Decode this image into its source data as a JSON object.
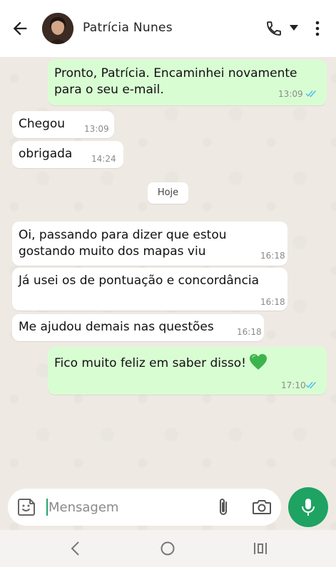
{
  "header": {
    "contact_name": "Patrícia Nunes",
    "icons": [
      "back-arrow-icon",
      "avatar",
      "phone-icon",
      "caret-down-icon",
      "more-vertical-icon"
    ]
  },
  "messages": [
    {
      "direction": "out",
      "lines": [
        "Pronto, Patrícia. Encaminhei novamente",
        "para o seu e-mail."
      ],
      "time": "13:09",
      "status": "read"
    },
    {
      "direction": "in",
      "lines": [
        "Chegou"
      ],
      "time": "13:09"
    },
    {
      "direction": "in",
      "lines": [
        "obrigada"
      ],
      "time": "14:24"
    },
    {
      "direction": "in",
      "lines": [
        "Oi, passando para dizer que estou",
        "gostando muito dos mapas viu"
      ],
      "time": "16:18"
    },
    {
      "direction": "in",
      "lines": [
        "Já usei os de pontuação e concordância"
      ],
      "time": "16:18"
    },
    {
      "direction": "in",
      "lines": [
        "Me ajudou demais nas questões"
      ],
      "time": "16:18"
    },
    {
      "direction": "out",
      "lines": [
        "Fico muito feliz em saber disso!"
      ],
      "emoji": "green-heart",
      "time": "17:10",
      "status": "read"
    }
  ],
  "date_divider": "Hoje",
  "composer": {
    "placeholder": "Mensagem",
    "icons": [
      "sticker-icon",
      "attach-icon",
      "camera-icon",
      "mic-icon"
    ]
  },
  "colors": {
    "outgoing_bubble": "#d9fdd3",
    "incoming_bubble": "#ffffff",
    "read_ticks": "#53bdeb",
    "mic_button": "#1ea362",
    "heart": "#3cb44b"
  }
}
